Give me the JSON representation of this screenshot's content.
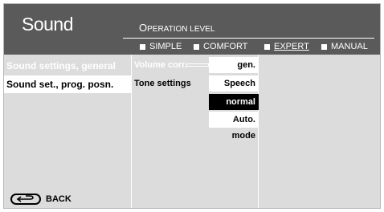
{
  "header": {
    "title": "Sound",
    "operation_level_first": "O",
    "operation_level_rest": "PERATION LEVEL",
    "modes": [
      {
        "label": "SIMPLE"
      },
      {
        "label": "COMFORT"
      },
      {
        "label": "EXPERT",
        "selected": true
      },
      {
        "label": "MANUAL"
      }
    ]
  },
  "left_menu": {
    "items": [
      {
        "label": "Sound settings, general"
      },
      {
        "label": "Sound set., prog. posn.",
        "selected": true
      }
    ]
  },
  "middle_menu": {
    "volume_corr": "Volume corr.",
    "tone_settings": "Tone settings"
  },
  "options": [
    "gen.",
    "Speech",
    "normal",
    "Auto. mode"
  ],
  "selected_option": "normal",
  "footer": {
    "back_label": "BACK"
  },
  "colors": {
    "header_bg": "#5a5a5a",
    "panel_bg": "#dcdcdc",
    "highlight_bg": "#ffffff",
    "selected_bg": "#000000"
  }
}
